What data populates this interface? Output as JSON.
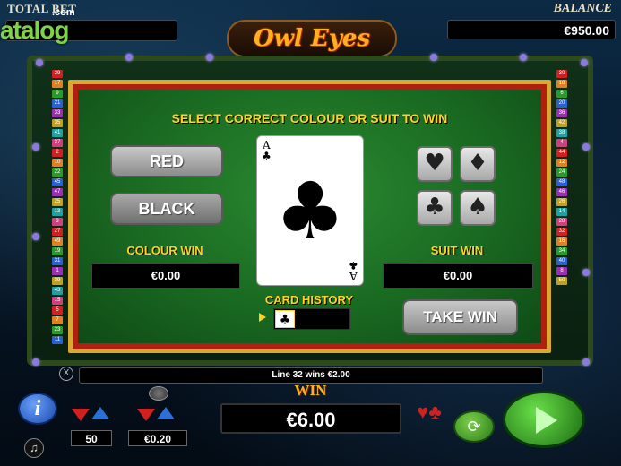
{
  "header": {
    "total_bet_label": "TOTAL BET",
    "total_bet_value": "",
    "balance_label": "BALANCE",
    "balance_value": "€950.00",
    "watermark": "atalog",
    "watermark_com": ".com",
    "logo": "Owl Eyes"
  },
  "gamble": {
    "title": "SELECT CORRECT COLOUR OR SUIT TO WIN",
    "red_label": "RED",
    "black_label": "BLACK",
    "colour_win_label": "COLOUR WIN",
    "colour_win_value": "€0.00",
    "suit_win_label": "SUIT WIN",
    "suit_win_value": "€0.00",
    "card_rank": "A",
    "card_suit": "♣",
    "card_history_label": "CARD HISTORY",
    "history_suit": "♣",
    "suits": [
      "♥",
      "♦",
      "♣",
      "♠"
    ],
    "take_win_label": "TAKE WIN"
  },
  "status": {
    "line_text": "Line 32 wins €2.00",
    "close_symbol": "X"
  },
  "controls": {
    "info_label": "i",
    "sound_symbol": "♫",
    "lines_value": "50",
    "bet_value": "€0.20",
    "win_label": "WIN",
    "win_value": "€6.00",
    "gamble_symbol": "♥♣",
    "autoplay_symbol": "⟳"
  },
  "line_numbers_left": [
    "29",
    "17",
    "9",
    "21",
    "33",
    "35",
    "41",
    "37",
    "2",
    "10",
    "22",
    "45",
    "47",
    "25",
    "13",
    "3",
    "27",
    "49",
    "19",
    "31",
    "1",
    "39",
    "43",
    "15",
    "5",
    "7",
    "23",
    "11"
  ],
  "line_numbers_right": [
    "30",
    "18",
    "6",
    "20",
    "36",
    "42",
    "38",
    "4",
    "44",
    "12",
    "24",
    "48",
    "46",
    "26",
    "14",
    "28",
    "32",
    "16",
    "34",
    "40",
    "8",
    "50"
  ]
}
